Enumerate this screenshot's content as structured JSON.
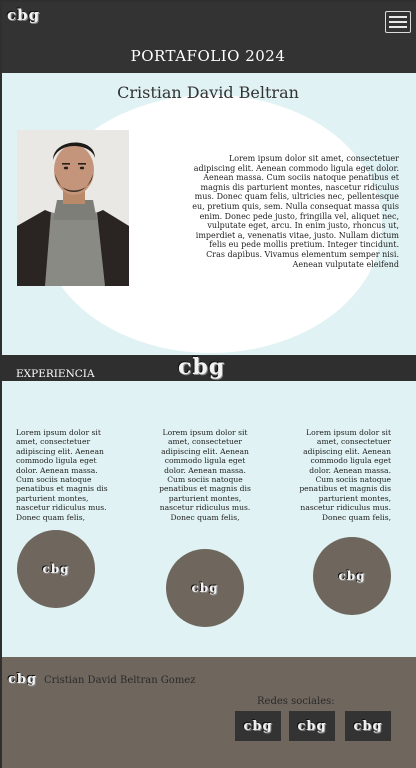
{
  "header": {
    "logo": "cbg",
    "title": "PORTAFOLIO 2024",
    "menu_icon": "hamburger-menu-icon"
  },
  "hero": {
    "name": "Cristian David Beltran",
    "photo": "portrait-photo",
    "bio": "Lorem ipsum dolor sit amet, consectetuer adipiscing elit. Aenean commodo ligula eget dolor. Aenean massa. Cum sociis natoque penatibus et magnis dis parturient montes, nascetur ridiculus mus. Donec quam felis, ultricies nec, pellentesque eu, pretium quis, sem. Nulla consequat massa quis enim. Donec pede justo, fringilla vel, aliquet nec, vulputate eget, arcu. In enim justo, rhoncus ut, imperdiet a, venenatis vitae, justo. Nullam dictum felis eu pede mollis pretium. Integer tincidunt. Cras dapibus. Vivamus elementum semper nisi. Aenean vulputate eleifend"
  },
  "experience": {
    "label": "EXPERIENCIA",
    "logo": "cbg",
    "columns": [
      {
        "text": "Lorem ipsum dolor sit amet, consectetuer adipiscing elit. Aenean commodo ligula eget dolor. Aenean massa. Cum sociis natoque penatibus et magnis dis parturient montes, nascetur ridiculus mus. Donec quam felis,",
        "logo": "cbg"
      },
      {
        "text": "Lorem ipsum dolor sit amet, consectetuer adipiscing elit. Aenean commodo ligula eget dolor. Aenean massa. Cum sociis natoque penatibus et magnis dis parturient montes, nascetur ridiculus mus. Donec quam felis,",
        "logo": "cbg"
      },
      {
        "text": "Lorem ipsum dolor sit amet, consectetuer adipiscing elit. Aenean commodo ligula eget dolor. Aenean massa. Cum sociis natoque penatibus et magnis dis parturient montes, nascetur ridiculus mus. Donec quam felis,",
        "logo": "cbg"
      }
    ]
  },
  "footer": {
    "logo": "cbg",
    "name": "Cristian David Beltran Gomez",
    "socials_label": "Redes sociales:",
    "socials": [
      "cbg",
      "cbg",
      "cbg"
    ]
  },
  "colors": {
    "dark": "#333333",
    "light_teal": "#e0f2f3",
    "taupe": "#6f665e"
  }
}
